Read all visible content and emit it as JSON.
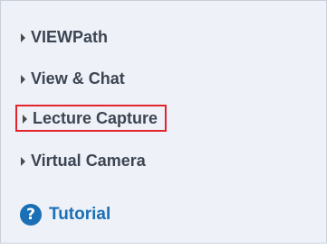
{
  "menu": {
    "items": [
      {
        "label": "VIEWPath"
      },
      {
        "label": "View & Chat"
      },
      {
        "label": "Lecture Capture"
      },
      {
        "label": "Virtual Camera"
      }
    ]
  },
  "tutorial": {
    "icon_glyph": "?",
    "label": "Tutorial"
  },
  "colors": {
    "panel_background": "#eef2f8",
    "highlight_border": "#e3242b",
    "tutorial_blue": "#1b6fb5",
    "menu_text": "#3d4552"
  }
}
